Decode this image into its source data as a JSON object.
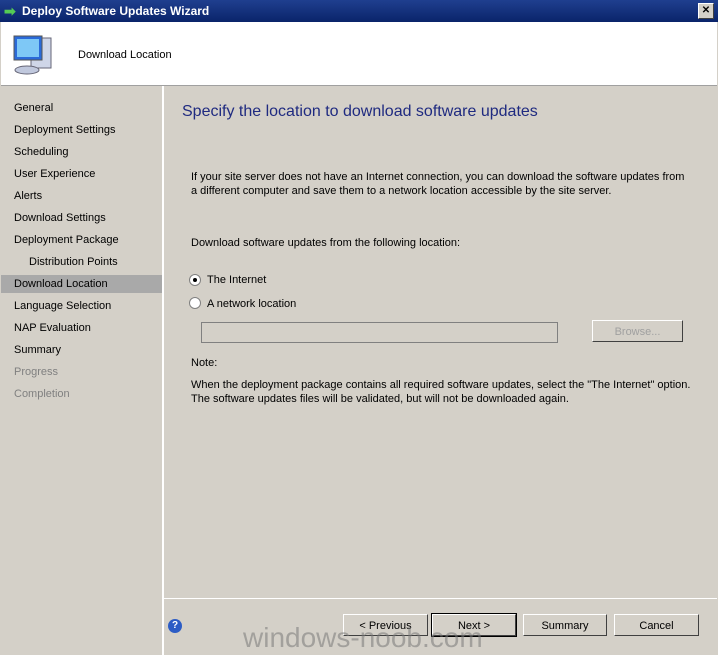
{
  "window": {
    "title": "Deploy Software Updates Wizard",
    "close": "✕"
  },
  "header": {
    "title": "Download Location"
  },
  "sidebar": {
    "items": [
      {
        "label": "General",
        "state": "normal"
      },
      {
        "label": "Deployment Settings",
        "state": "normal"
      },
      {
        "label": "Scheduling",
        "state": "normal"
      },
      {
        "label": "User Experience",
        "state": "normal"
      },
      {
        "label": "Alerts",
        "state": "normal"
      },
      {
        "label": "Download Settings",
        "state": "normal"
      },
      {
        "label": "Deployment Package",
        "state": "normal"
      },
      {
        "label": "Distribution Points",
        "state": "normal"
      },
      {
        "label": "Download Location",
        "state": "selected"
      },
      {
        "label": "Language Selection",
        "state": "normal"
      },
      {
        "label": "NAP Evaluation",
        "state": "normal"
      },
      {
        "label": "Summary",
        "state": "normal"
      },
      {
        "label": "Progress",
        "state": "disabled"
      },
      {
        "label": "Completion",
        "state": "disabled"
      }
    ]
  },
  "main": {
    "heading": "Specify the location to download software updates",
    "intro": "If your site server does not have an Internet connection, you can download the software updates from a different computer and save them to a network location accessible by the site server.",
    "prompt": "Download software updates from the following location:",
    "options": [
      {
        "label": "The Internet",
        "selected": true
      },
      {
        "label": "A network location",
        "selected": false
      }
    ],
    "path_value": "",
    "browse": "Browse...",
    "note_label": "Note:",
    "note": "When the deployment package contains all required software updates, select the \"The Internet\" option. The software updates files will be validated, but will not be downloaded again."
  },
  "footer": {
    "help": "?",
    "previous": "< Previous",
    "next": "Next >",
    "summary": "Summary",
    "cancel": "Cancel"
  },
  "watermark": "windows-noob.com"
}
